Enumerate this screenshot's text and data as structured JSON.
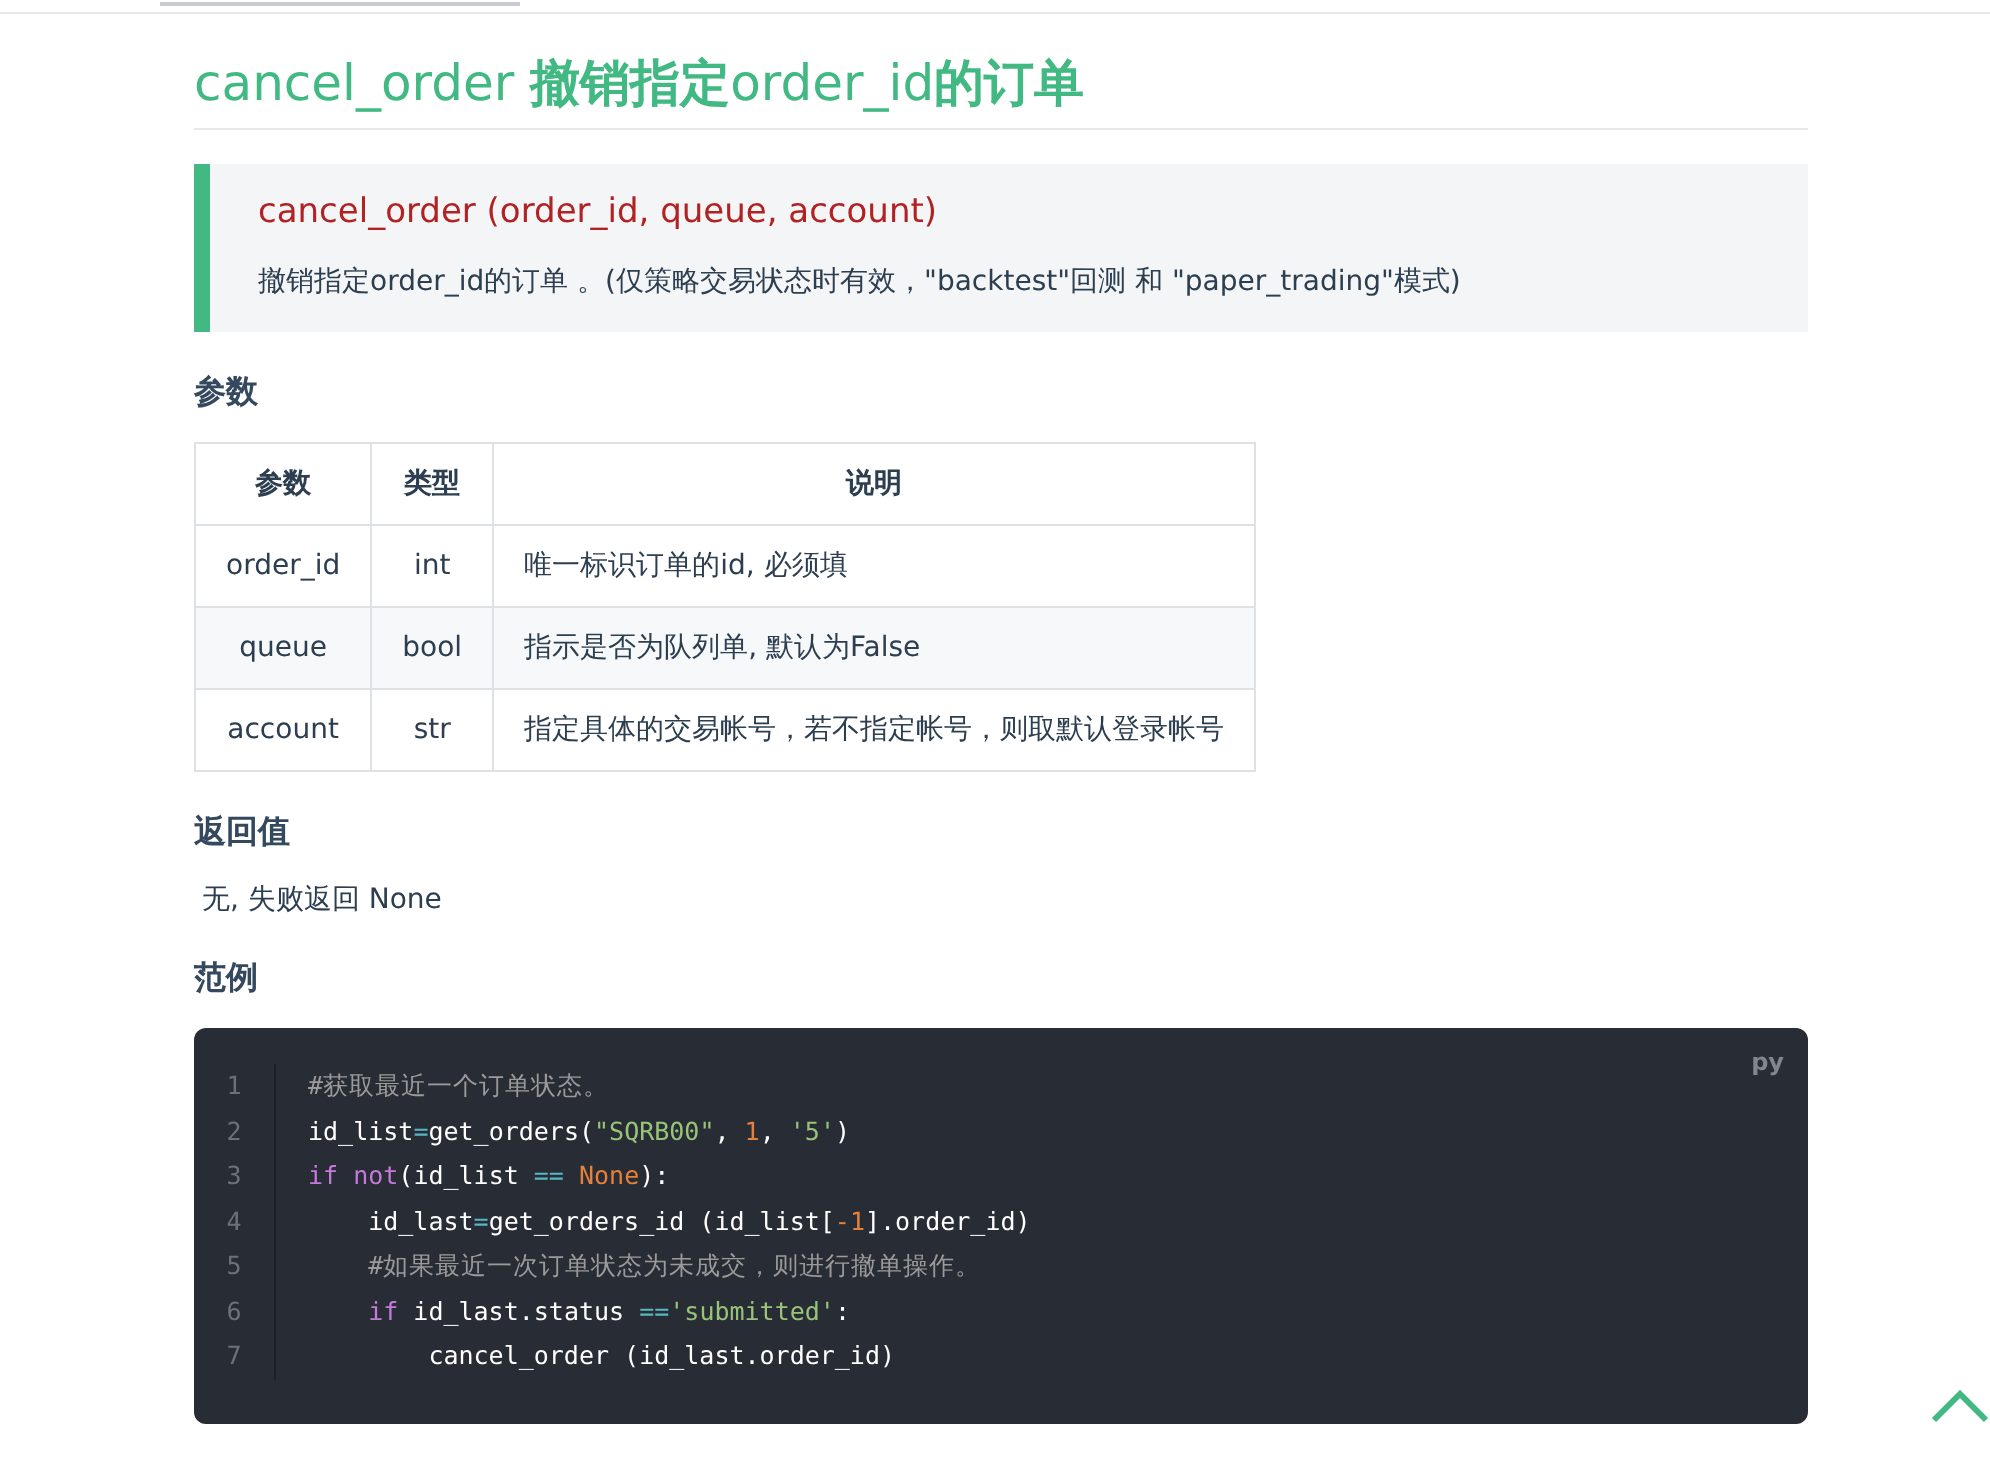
{
  "title": "cancel_order **撤销指定**order_id**的订单**",
  "signature": {
    "name": "cancel_order (order_id, queue, account)",
    "description": "撤销指定order_id的订单 。(仅策略交易状态时有效，\"backtest\"回测 和 \"paper_trading\"模式)"
  },
  "params_heading": "参数",
  "params_table": {
    "columns": [
      "参数",
      "类型",
      "说明"
    ],
    "rows": [
      [
        "order_id",
        "int",
        "唯一标识订单的id, 必须填"
      ],
      [
        "queue",
        "bool",
        "指示是否为队列单, 默认为False"
      ],
      [
        "account",
        "str",
        "指定具体的交易帐号，若不指定帐号，则取默认登录帐号"
      ]
    ]
  },
  "return_heading": "返回值",
  "return_text": "无, 失败返回 None",
  "example_heading": "范例",
  "code": {
    "language": "py",
    "lines": [
      {
        "number": "1",
        "tokens": [
          {
            "kind": "comment",
            "text": "#获取最近一个订单状态。"
          }
        ]
      },
      {
        "number": "2",
        "tokens": [
          {
            "kind": "plain",
            "text": "id_list"
          },
          {
            "kind": "op",
            "text": "="
          },
          {
            "kind": "plain",
            "text": "get_orders("
          },
          {
            "kind": "string",
            "text": "\"SQRB00\""
          },
          {
            "kind": "plain",
            "text": ", "
          },
          {
            "kind": "number",
            "text": "1"
          },
          {
            "kind": "plain",
            "text": ", "
          },
          {
            "kind": "string",
            "text": "'5'"
          },
          {
            "kind": "plain",
            "text": ")"
          }
        ]
      },
      {
        "number": "3",
        "tokens": [
          {
            "kind": "keyword",
            "text": "if"
          },
          {
            "kind": "keyword",
            "text": " not"
          },
          {
            "kind": "plain",
            "text": "(id_list "
          },
          {
            "kind": "op",
            "text": "=="
          },
          {
            "kind": "number",
            "text": " None"
          },
          {
            "kind": "plain",
            "text": "):"
          }
        ]
      },
      {
        "number": "4",
        "tokens": [
          {
            "kind": "plain",
            "text": "    id_last"
          },
          {
            "kind": "op",
            "text": "="
          },
          {
            "kind": "plain",
            "text": "get_orders_id (id_list["
          },
          {
            "kind": "number",
            "text": "-1"
          },
          {
            "kind": "plain",
            "text": "].order_id)"
          }
        ]
      },
      {
        "number": "5",
        "tokens": [
          {
            "kind": "comment",
            "text": "    #如果最近一次订单状态为未成交，则进行撤单操作。"
          }
        ]
      },
      {
        "number": "6",
        "tokens": [
          {
            "kind": "keyword",
            "text": "    if"
          },
          {
            "kind": "plain",
            "text": " id_last.status "
          },
          {
            "kind": "op",
            "text": "=="
          },
          {
            "kind": "string",
            "text": "'submitted'"
          },
          {
            "kind": "plain",
            "text": ":"
          }
        ]
      },
      {
        "number": "7",
        "tokens": [
          {
            "kind": "plain",
            "text": "        cancel_order (id_last.order_id)"
          }
        ]
      }
    ]
  }
}
